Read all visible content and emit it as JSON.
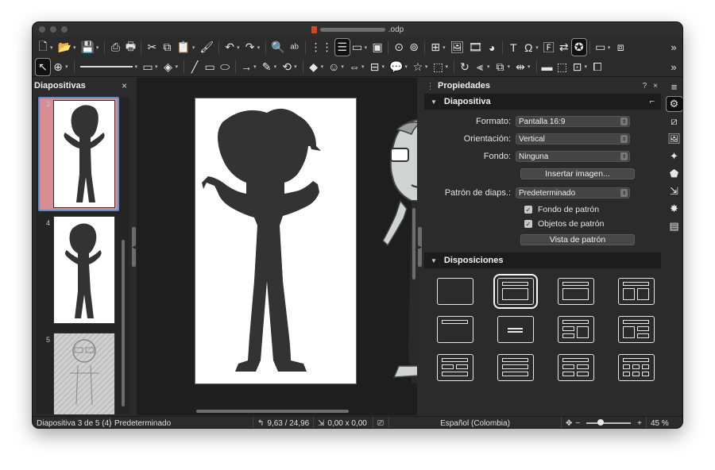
{
  "window": {
    "title_ext": ".odp"
  },
  "toolbar_more": "»",
  "slides_panel": {
    "title": "Diapositivas",
    "close": "×",
    "thumbs": [
      {
        "num": "3",
        "selected": true
      },
      {
        "num": "4",
        "selected": false
      },
      {
        "num": "5",
        "selected": false
      }
    ]
  },
  "properties": {
    "title": "Propiedades",
    "help": "?",
    "close": "×",
    "menu": "≡",
    "slide_section": {
      "title": "Diapositiva",
      "format_label": "Formato:",
      "format_value": "Pantalla 16:9",
      "orientation_label": "Orientación:",
      "orientation_value": "Vertical",
      "background_label": "Fondo:",
      "background_value": "Ninguna",
      "insert_image": "Insertar imagen...",
      "master_label": "Patrón de diaps.:",
      "master_value": "Predeterminado",
      "master_background": "Fondo de patrón",
      "master_objects": "Objetos de patrón",
      "master_view": "Vista de patrón"
    },
    "layouts_section": {
      "title": "Disposiciones"
    }
  },
  "statusbar": {
    "slide_info": "Diapositiva 3 de 5 (4)",
    "master": "Predeterminado",
    "position": "9,63 / 24,96",
    "size": "0,00 x 0,00",
    "language": "Español (Colombia)",
    "zoom_minus": "−",
    "zoom_plus": "+",
    "zoom": "45 %",
    "zoom_level_percent": 45
  }
}
